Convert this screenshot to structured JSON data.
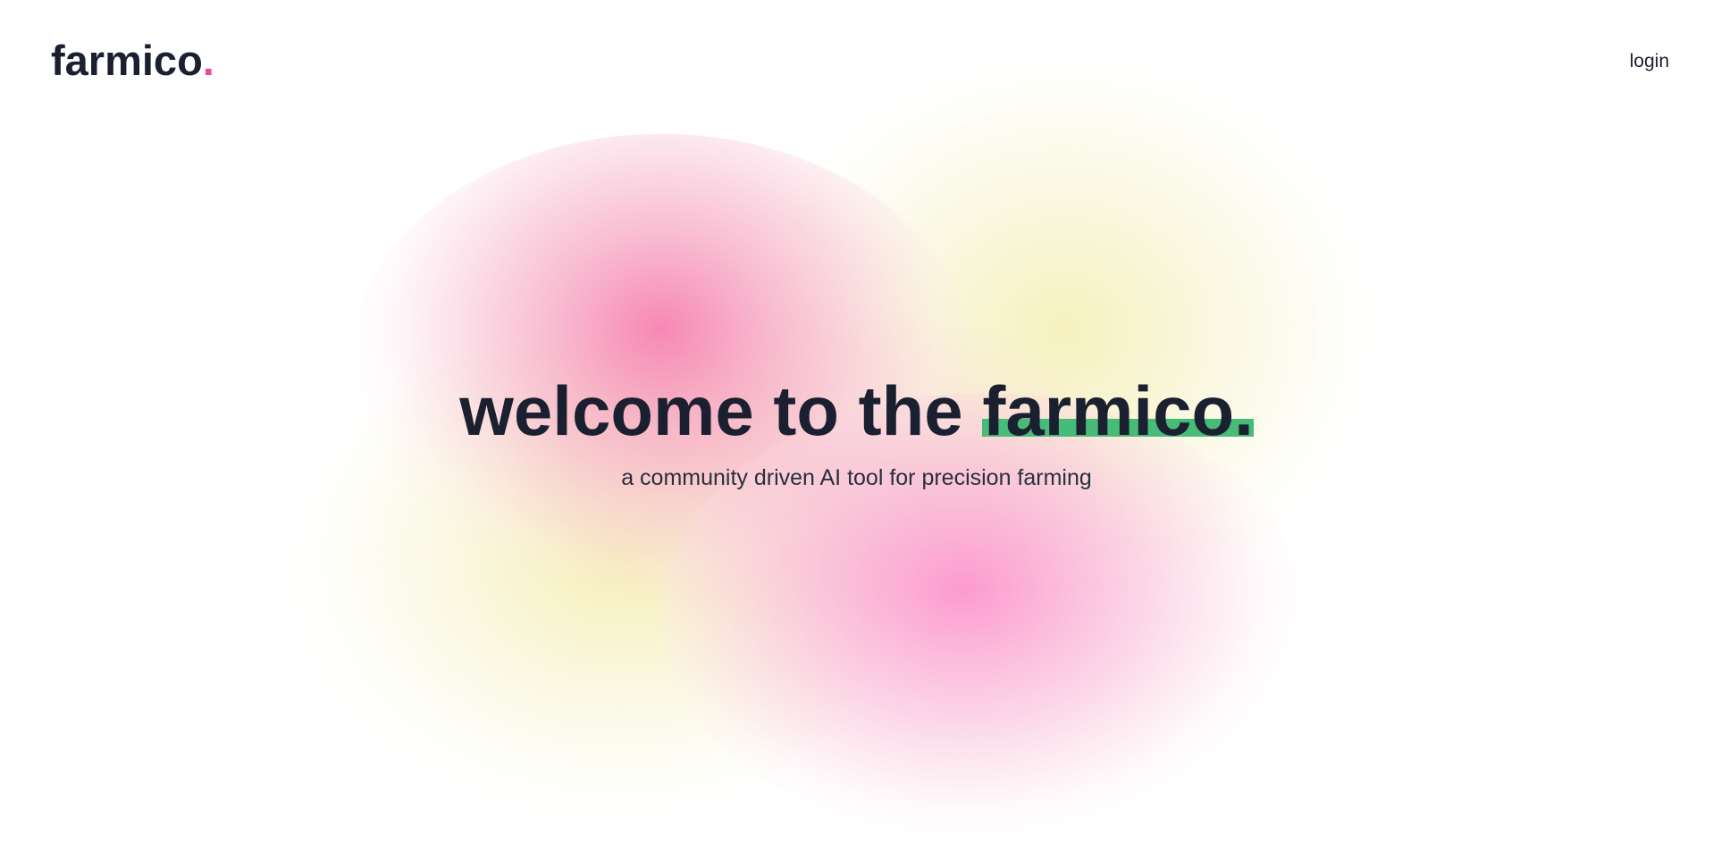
{
  "header": {
    "logo_text": "farmico",
    "logo_dot": ".",
    "login_label": "login"
  },
  "hero": {
    "title_prefix": "welcome to the ",
    "title_highlight": "farmico.",
    "subtitle": "a community driven AI tool for precision farming"
  },
  "colors": {
    "text": "#1b2030",
    "accent_pink": "#ec4899",
    "highlight_green": "#48bb78",
    "background": "#ffffff"
  }
}
